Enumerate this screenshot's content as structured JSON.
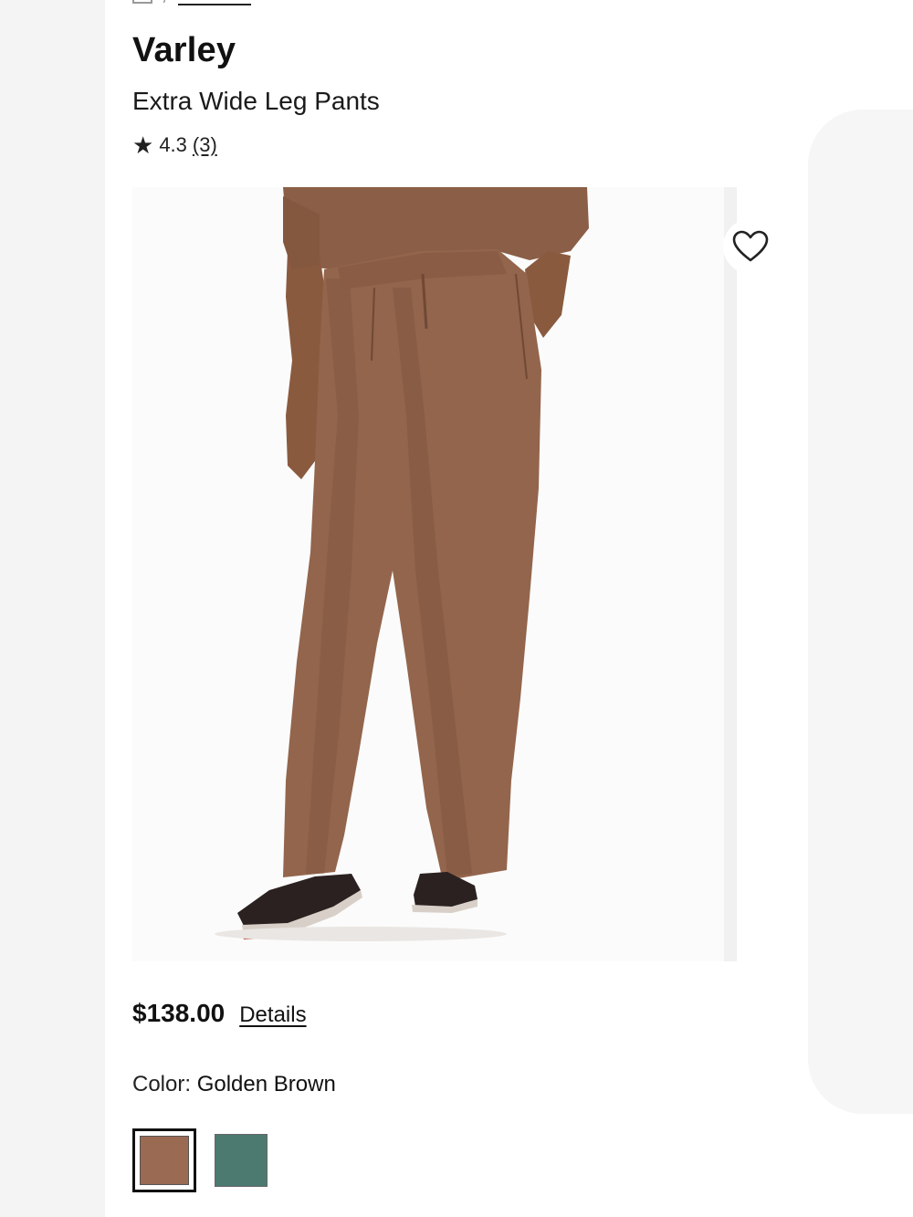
{
  "product": {
    "brand": "Varley",
    "name": "Extra Wide Leg Pants",
    "rating": "4.3",
    "review_count": "(3)",
    "price": "$138.00",
    "details_link": "Details",
    "color_label": "Color:",
    "color_value": "Golden Brown"
  },
  "icons": {
    "rating": "star-icon",
    "wishlist": "heart-outline-icon",
    "breadcrumb_home": "home-icon"
  },
  "colors": {
    "swatch_golden_brown": "#9a6a52",
    "swatch_green": "#4c7a70",
    "pants": "#93654c",
    "pants_shadow": "#7a503b",
    "skin": "#8a5a3f",
    "shoe": "#2a2120"
  },
  "swatches": [
    {
      "name": "Golden Brown",
      "selected": true
    },
    {
      "name": "Green",
      "selected": false
    }
  ]
}
